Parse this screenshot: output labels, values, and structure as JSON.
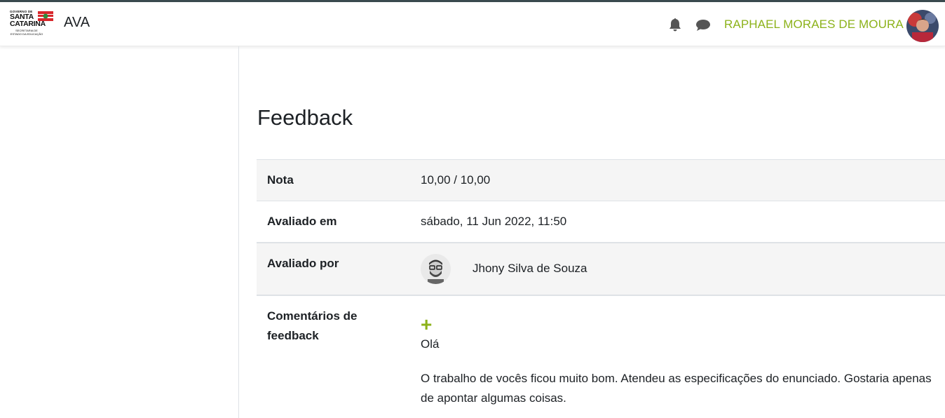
{
  "navbar": {
    "logo_line1": "GOVERNO DE",
    "logo_line2": "SANTA",
    "logo_line3": "CATARINA",
    "logo_line4": "SECRETARIA DE ESTADO DA EDUCAÇÃO",
    "brand": "AVA",
    "icons": [
      "bell-icon",
      "chat-icon"
    ],
    "user_name": "RAPHAEL MORAES DE MOURA",
    "accent_color": "#8cb21a"
  },
  "page": {
    "title": "Feedback"
  },
  "feedback": {
    "grade_label": "Nota",
    "grade_value": "10,00 / 10,00",
    "graded_on_label": "Avaliado em",
    "graded_on_value": "sábado, 11 Jun 2022, 11:50",
    "graded_by_label": "Avaliado por",
    "graded_by_value": "Jhony Silva de Souza",
    "comments_label": "Comentários de feedback",
    "comment_greeting": "Olá",
    "comment_body": "O trabalho de vocês ficou muito bom. Atendeu as especificações do enunciado. Gostaria apenas de apontar algumas coisas."
  }
}
